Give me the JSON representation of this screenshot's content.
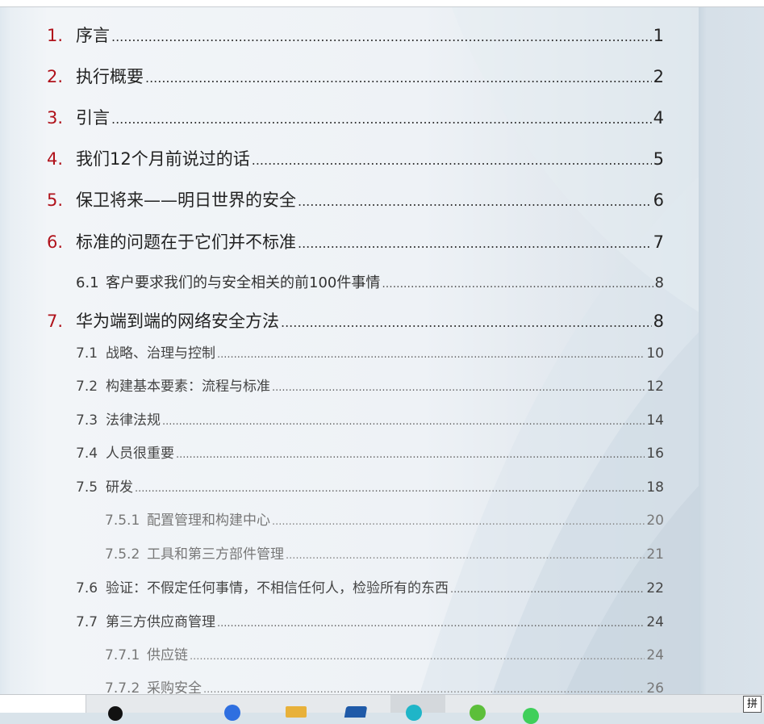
{
  "toc": [
    {
      "num": "1.",
      "title": "序言",
      "page": "1"
    },
    {
      "num": "2.",
      "title": "执行概要",
      "page": "2"
    },
    {
      "num": "3.",
      "title": "引言",
      "page": "4"
    },
    {
      "num": "4.",
      "title": "我们12个月前说过的话",
      "page": "5"
    },
    {
      "num": "5.",
      "title": "保卫将来——明日世界的安全",
      "page": "6"
    },
    {
      "num": "6.",
      "title": "标准的问题在于它们并不标准",
      "page": "7"
    },
    {
      "num": "6.1",
      "title": "客户要求我们的与安全相关的前100件事情",
      "page": "8"
    },
    {
      "num": "7.",
      "title": "华为端到端的网络安全方法",
      "page": "8"
    },
    {
      "num": "7.1",
      "title": "战略、治理与控制",
      "page": "10"
    },
    {
      "num": "7.2",
      "title": "构建基本要素：流程与标准",
      "page": "12"
    },
    {
      "num": "7.3",
      "title": "法律法规",
      "page": "14"
    },
    {
      "num": "7.4",
      "title": "人员很重要",
      "page": "16"
    },
    {
      "num": "7.5",
      "title": "研发",
      "page": "18"
    },
    {
      "num": "7.5.1",
      "title": "配置管理和构建中心",
      "page": "20"
    },
    {
      "num": "7.5.2",
      "title": "工具和第三方部件管理",
      "page": "21"
    },
    {
      "num": "7.6",
      "title": "验证：不假定任何事情，不相信任何人，检验所有的东西",
      "page": "22"
    },
    {
      "num": "7.7",
      "title": "第三方供应商管理",
      "page": "24"
    },
    {
      "num": "7.7.1",
      "title": "供应链",
      "page": "24"
    },
    {
      "num": "7.7.2",
      "title": "采购安全",
      "page": "26"
    }
  ],
  "taskbar": {
    "ime_indicator": "拼"
  }
}
